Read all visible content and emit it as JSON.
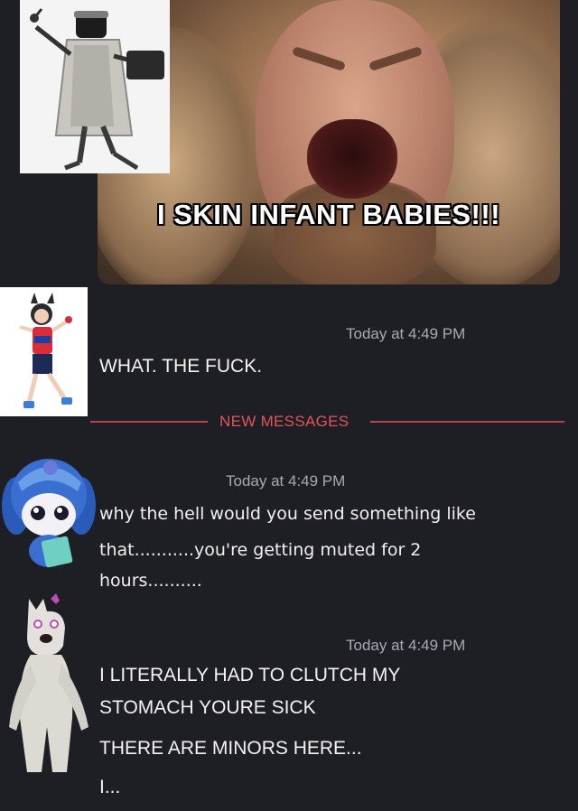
{
  "meme": {
    "caption": "I SKIN INFANT BABIES!!!"
  },
  "messages": [
    {
      "timestamp": "Today at 4:49 PM",
      "lines": [
        "WHAT. THE FUCK."
      ]
    },
    {
      "timestamp": "Today at 4:49 PM",
      "lines": [
        "why the hell would you send something like",
        "that...........you're getting muted for 2",
        "hours.........."
      ]
    },
    {
      "timestamp": "Today at 4:49 PM",
      "lines": [
        "I LITERALLY HAD TO CLUTCH MY",
        "STOMACH YOURE SICK",
        "THERE ARE MINORS HERE...",
        "I..."
      ]
    }
  ],
  "divider": {
    "label": "NEW MESSAGES"
  },
  "colors": {
    "background": "#1e1f24",
    "new_messages_accent": "#e0545c",
    "timestamp": "#a8aab2"
  }
}
